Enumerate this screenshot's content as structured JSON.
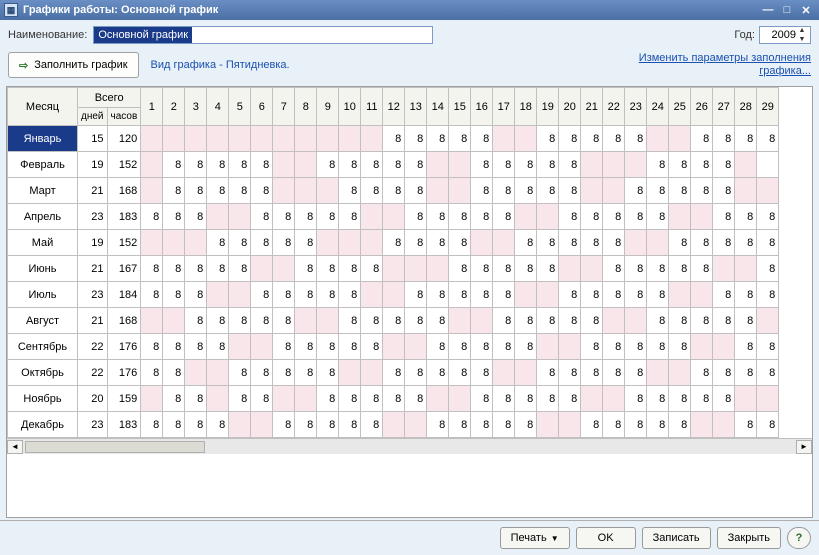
{
  "window": {
    "title": "Графики работы: Основной график"
  },
  "header": {
    "name_label": "Наименование:",
    "name_value": "Основной график",
    "year_label": "Год:",
    "year_value": "2009"
  },
  "toolbar": {
    "fill_label": "Заполнить график",
    "schedule_type": "Вид графика - Пятидневка.",
    "change_params_line1": "Изменить параметры заполнения",
    "change_params_line2": "графика..."
  },
  "grid": {
    "headers": {
      "month": "Месяц",
      "total": "Всего",
      "days_sub": "дней",
      "hours_sub": "часов"
    },
    "day_numbers": [
      1,
      2,
      3,
      4,
      5,
      6,
      7,
      8,
      9,
      10,
      11,
      12,
      13,
      14,
      15,
      16,
      17,
      18,
      19,
      20,
      21,
      22,
      23,
      24,
      25,
      26,
      27,
      28,
      29
    ],
    "months": [
      {
        "name": "Январь",
        "days": 15,
        "hours": 120,
        "weekends": [
          1,
          2,
          3,
          4,
          5,
          6,
          7,
          8,
          9,
          10,
          11,
          17,
          18,
          24,
          25
        ],
        "cells": {
          "12": 8,
          "13": 8,
          "14": 8,
          "15": 8,
          "16": 8,
          "19": 8,
          "20": 8,
          "21": 8,
          "22": 8,
          "23": 8,
          "26": 8,
          "27": 8,
          "28": 8,
          "29": 8
        }
      },
      {
        "name": "Февраль",
        "days": 19,
        "hours": 152,
        "weekends": [
          1,
          7,
          8,
          14,
          15,
          21,
          22,
          23,
          28
        ],
        "cells": {
          "2": 8,
          "3": 8,
          "4": 8,
          "5": 8,
          "6": 8,
          "9": 8,
          "10": 8,
          "11": 8,
          "12": 8,
          "13": 8,
          "16": 8,
          "17": 8,
          "18": 8,
          "19": 8,
          "20": 8,
          "24": 8,
          "25": 8,
          "26": 8,
          "27": 8
        }
      },
      {
        "name": "Март",
        "days": 21,
        "hours": 168,
        "weekends": [
          1,
          7,
          8,
          9,
          14,
          15,
          21,
          22,
          28,
          29
        ],
        "cells": {
          "2": 8,
          "3": 8,
          "4": 8,
          "5": 8,
          "6": 8,
          "10": 8,
          "11": 8,
          "12": 8,
          "13": 8,
          "16": 8,
          "17": 8,
          "18": 8,
          "19": 8,
          "20": 8,
          "23": 8,
          "24": 8,
          "25": 8,
          "26": 8,
          "27": 8
        }
      },
      {
        "name": "Апрель",
        "days": 23,
        "hours": 183,
        "weekends": [
          4,
          5,
          11,
          12,
          18,
          19,
          25,
          26
        ],
        "cells": {
          "1": 8,
          "2": 8,
          "3": 8,
          "6": 8,
          "7": 8,
          "8": 8,
          "9": 8,
          "10": 8,
          "13": 8,
          "14": 8,
          "15": 8,
          "16": 8,
          "17": 8,
          "20": 8,
          "21": 8,
          "22": 8,
          "23": 8,
          "24": 8,
          "27": 8,
          "28": 8,
          "29": 8
        }
      },
      {
        "name": "Май",
        "days": 19,
        "hours": 152,
        "weekends": [
          1,
          2,
          3,
          9,
          10,
          11,
          16,
          17,
          23,
          24
        ],
        "cells": {
          "4": 8,
          "5": 8,
          "6": 8,
          "7": 8,
          "8": 8,
          "12": 8,
          "13": 8,
          "14": 8,
          "15": 8,
          "18": 8,
          "19": 8,
          "20": 8,
          "21": 8,
          "22": 8,
          "25": 8,
          "26": 8,
          "27": 8,
          "28": 8,
          "29": 8
        }
      },
      {
        "name": "Июнь",
        "days": 21,
        "hours": 167,
        "weekends": [
          6,
          7,
          12,
          13,
          14,
          20,
          21,
          27,
          28
        ],
        "cells": {
          "1": 8,
          "2": 8,
          "3": 8,
          "4": 8,
          "5": 8,
          "8": 8,
          "9": 8,
          "10": 8,
          "11": 8,
          "15": 8,
          "16": 8,
          "17": 8,
          "18": 8,
          "19": 8,
          "22": 8,
          "23": 8,
          "24": 8,
          "25": 8,
          "26": 8,
          "29": 8
        }
      },
      {
        "name": "Июль",
        "days": 23,
        "hours": 184,
        "weekends": [
          4,
          5,
          11,
          12,
          18,
          19,
          25,
          26
        ],
        "cells": {
          "1": 8,
          "2": 8,
          "3": 8,
          "6": 8,
          "7": 8,
          "8": 8,
          "9": 8,
          "10": 8,
          "13": 8,
          "14": 8,
          "15": 8,
          "16": 8,
          "17": 8,
          "20": 8,
          "21": 8,
          "22": 8,
          "23": 8,
          "24": 8,
          "27": 8,
          "28": 8,
          "29": 8
        }
      },
      {
        "name": "Август",
        "days": 21,
        "hours": 168,
        "weekends": [
          1,
          2,
          8,
          9,
          15,
          16,
          22,
          23,
          29
        ],
        "cells": {
          "3": 8,
          "4": 8,
          "5": 8,
          "6": 8,
          "7": 8,
          "10": 8,
          "11": 8,
          "12": 8,
          "13": 8,
          "14": 8,
          "17": 8,
          "18": 8,
          "19": 8,
          "20": 8,
          "21": 8,
          "24": 8,
          "25": 8,
          "26": 8,
          "27": 8,
          "28": 8
        }
      },
      {
        "name": "Сентябрь",
        "days": 22,
        "hours": 176,
        "weekends": [
          5,
          6,
          12,
          13,
          19,
          20,
          26,
          27
        ],
        "cells": {
          "1": 8,
          "2": 8,
          "3": 8,
          "4": 8,
          "7": 8,
          "8": 8,
          "9": 8,
          "10": 8,
          "11": 8,
          "14": 8,
          "15": 8,
          "16": 8,
          "17": 8,
          "18": 8,
          "21": 8,
          "22": 8,
          "23": 8,
          "24": 8,
          "25": 8,
          "28": 8,
          "29": 8
        }
      },
      {
        "name": "Октябрь",
        "days": 22,
        "hours": 176,
        "weekends": [
          3,
          4,
          10,
          11,
          17,
          18,
          24,
          25
        ],
        "cells": {
          "1": 8,
          "2": 8,
          "5": 8,
          "6": 8,
          "7": 8,
          "8": 8,
          "9": 8,
          "12": 8,
          "13": 8,
          "14": 8,
          "15": 8,
          "16": 8,
          "19": 8,
          "20": 8,
          "21": 8,
          "22": 8,
          "23": 8,
          "26": 8,
          "27": 8,
          "28": 8,
          "29": 8
        }
      },
      {
        "name": "Ноябрь",
        "days": 20,
        "hours": 159,
        "weekends": [
          1,
          4,
          7,
          8,
          14,
          15,
          21,
          22,
          28,
          29
        ],
        "cells": {
          "2": 8,
          "3": 8,
          "5": 8,
          "6": 8,
          "9": 8,
          "10": 8,
          "11": 8,
          "12": 8,
          "13": 8,
          "16": 8,
          "17": 8,
          "18": 8,
          "19": 8,
          "20": 8,
          "23": 8,
          "24": 8,
          "25": 8,
          "26": 8,
          "27": 8
        }
      },
      {
        "name": "Декабрь",
        "days": 23,
        "hours": 183,
        "weekends": [
          5,
          6,
          12,
          13,
          19,
          20,
          26,
          27
        ],
        "cells": {
          "1": 8,
          "2": 8,
          "3": 8,
          "4": 8,
          "7": 8,
          "8": 8,
          "9": 8,
          "10": 8,
          "11": 8,
          "14": 8,
          "15": 8,
          "16": 8,
          "17": 8,
          "18": 8,
          "21": 8,
          "22": 8,
          "23": 8,
          "24": 8,
          "25": 8,
          "28": 8,
          "29": 8
        }
      }
    ]
  },
  "footer": {
    "print": "Печать",
    "ok": "OK",
    "save": "Записать",
    "close": "Закрыть"
  }
}
